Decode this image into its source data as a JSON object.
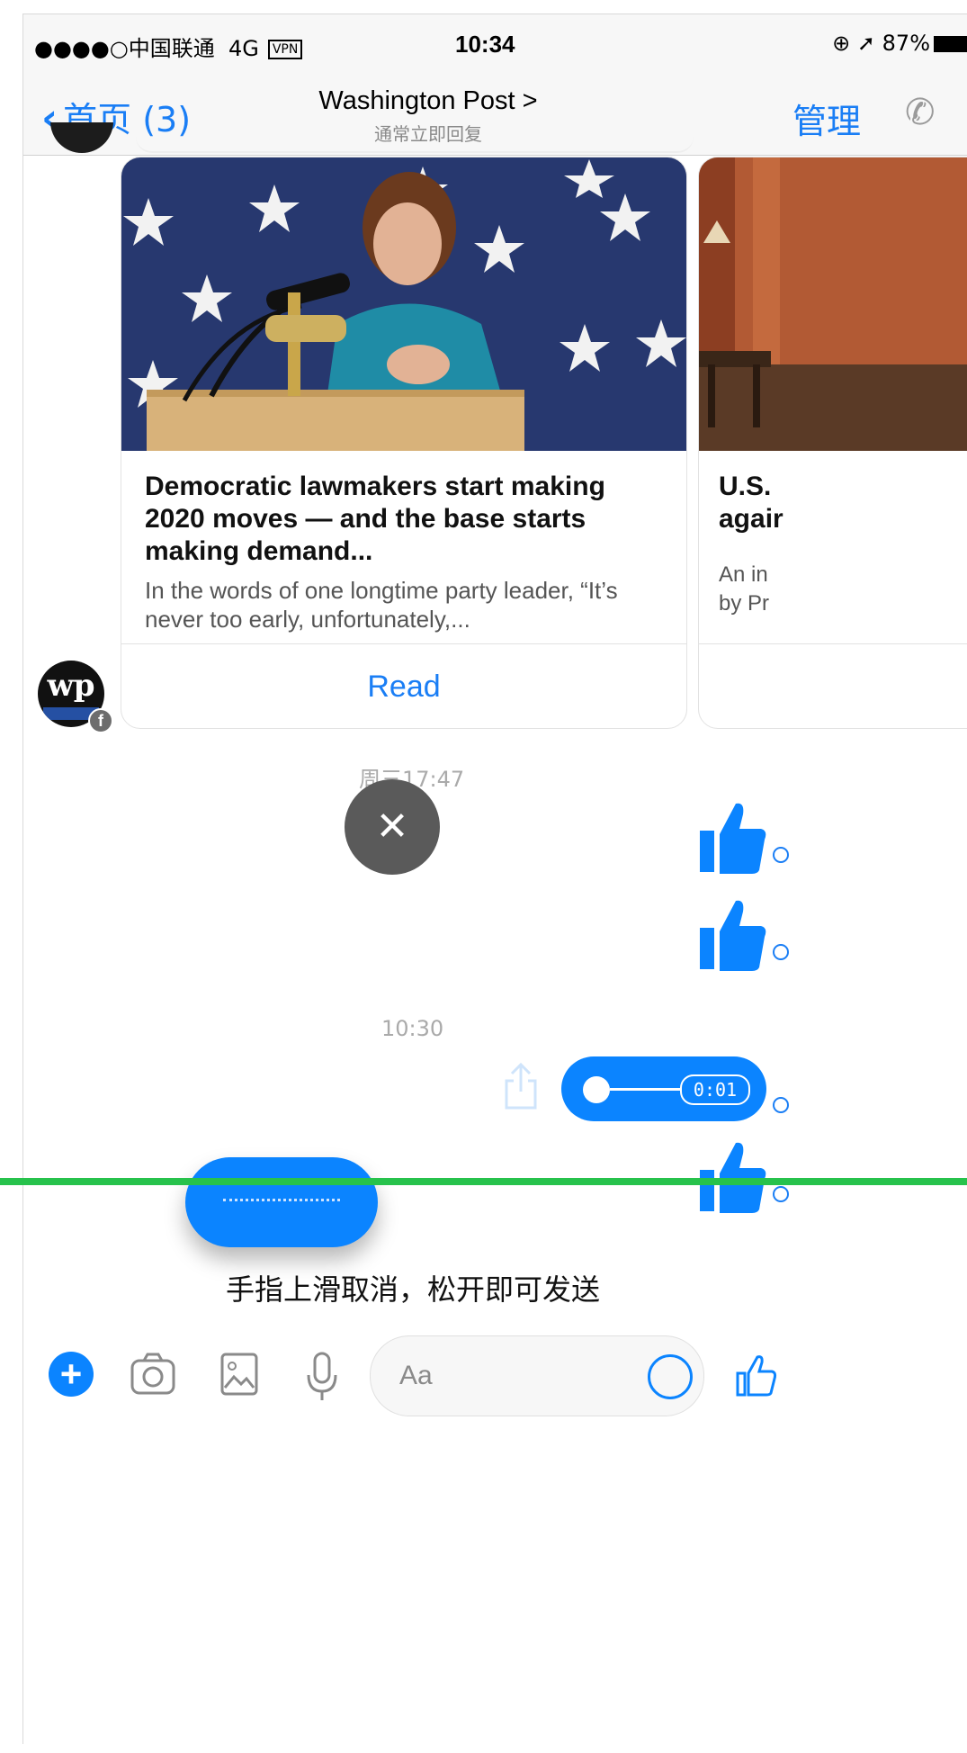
{
  "status_bar": {
    "carrier": "●●●●○中国联通",
    "network": "4G",
    "vpn": "VPN",
    "time": "10:34",
    "battery": "87%"
  },
  "nav": {
    "back_label": "首页 (3)",
    "title": "Washington Post >",
    "subtitle": "通常立即回复",
    "manage": "管理"
  },
  "cards": [
    {
      "title": "Democratic lawmakers start making 2020 moves — and the base starts making demand...",
      "description": "In the words of one longtime party leader, “It’s never too early, unfortunately,...",
      "button": "Read"
    },
    {
      "title_line1": "U.S.",
      "title_line2": "agair",
      "desc_line1": "An in",
      "desc_line2": "by Pr"
    }
  ],
  "timestamps": [
    "周三17:47",
    "10:30"
  ],
  "voice_message": {
    "duration": "0:01"
  },
  "hint": "手指上滑取消，松开即可发送",
  "composer": {
    "placeholder": "Aa"
  },
  "colors": {
    "accent": "#0b84ff",
    "link": "#1a7ef5",
    "guide_line": "#27c24c"
  }
}
